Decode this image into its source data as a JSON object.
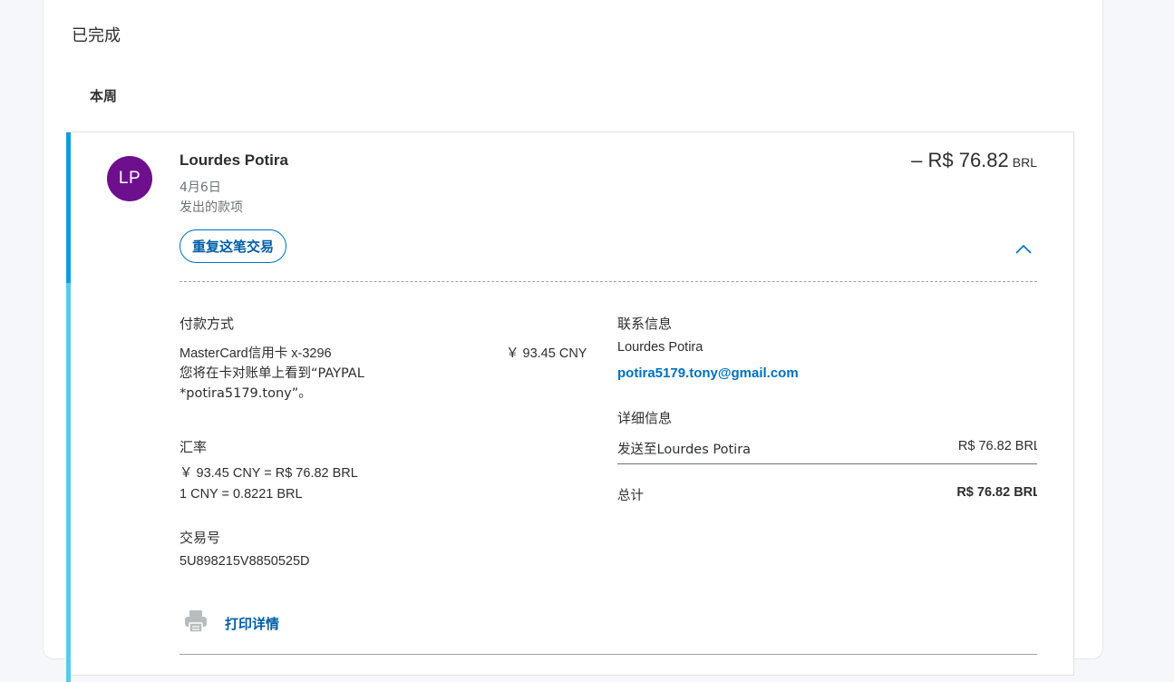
{
  "section": {
    "title": "已完成",
    "group_label": "本周"
  },
  "transaction": {
    "avatar_initials": "LP",
    "name": "Lourdes Potira",
    "date": "4月6日",
    "type": "发出的款项",
    "amount": "– R$ 76.82",
    "amount_currency": "BRL",
    "repeat_button": "重复这笔交易",
    "chevron_icon": "chevron-up-icon",
    "colors": {
      "accent_dark": "#0f9ddb",
      "accent_light": "#5ac8ed",
      "avatar_bg": "#6e0f8e",
      "link": "#0070ba"
    }
  },
  "payment": {
    "title": "付款方式",
    "card": "MasterCard信用卡 x-3296",
    "amount": "￥ 93.45 CNY",
    "note_line1": "您将在卡对账单上看到“PAYPAL",
    "note_line2": "*potira5179.tony”。"
  },
  "exchange": {
    "title": "汇率",
    "line1": "￥ 93.45 CNY = R$ 76.82 BRL",
    "line2": "1 CNY = 0.8221 BRL"
  },
  "transaction_id": {
    "title": "交易号",
    "value": "5U898215V8850525D"
  },
  "print": {
    "icon": "printer-icon",
    "label": "打印详情"
  },
  "contact": {
    "title": "联系信息",
    "name": "Lourdes Potira",
    "email": "potira5179.tony@gmail.com"
  },
  "details": {
    "title": "详细信息",
    "row_label": "发送至Lourdes Potira",
    "row_value": "R$ 76.82 BRL",
    "total_label": "总计",
    "total_value": "R$ 76.82 BRL"
  }
}
